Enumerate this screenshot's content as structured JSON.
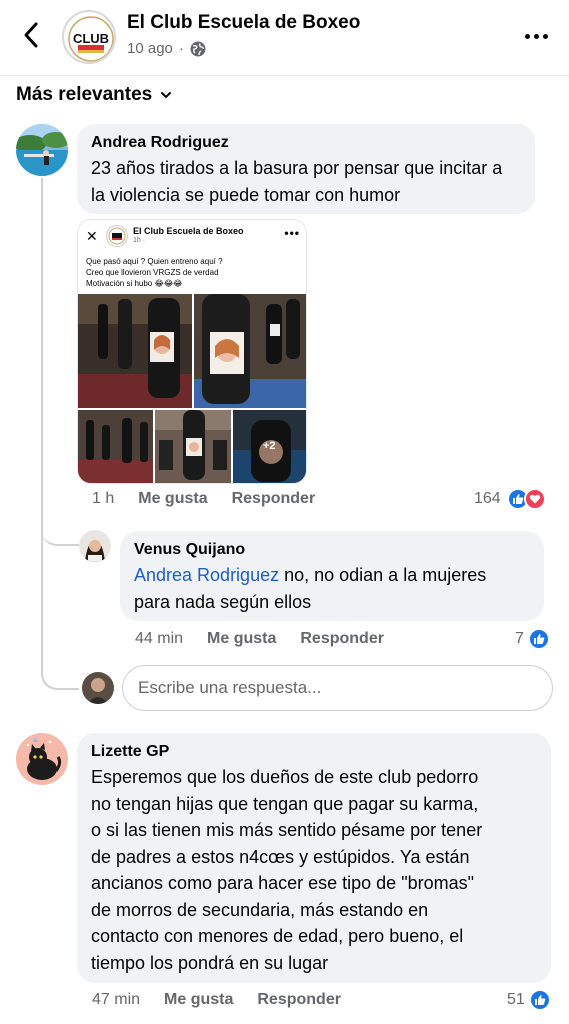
{
  "header": {
    "title": "El Club Escuela de Boxeo",
    "time": "10 ago",
    "dot": "·",
    "logo_text": "CLUB",
    "icons": {
      "back": "chevron-left-icon",
      "privacy": "globe-icon",
      "more": "more-dots-icon"
    }
  },
  "sort": {
    "label": "Más relevantes",
    "icon": "chevron-down-icon"
  },
  "comments": [
    {
      "author": "Andrea Rodriguez",
      "text": "23 años tirados a la basura por pensar que incitar a la violencia se puede tomar con humor",
      "time": "1 h",
      "like_label": "Me gusta",
      "reply_label": "Responder",
      "reaction_count": "164",
      "reactions": [
        "like",
        "love"
      ],
      "attachment": {
        "page_name": "El Club Escuela de Boxeo",
        "time": "1h · ",
        "close": "✕",
        "more": "•••",
        "lines": [
          "Que pasó aquí ? Quien entreno aquí ?",
          "Creo que llovieron VRGZS de verdad",
          "Motivación si hubo 😂😂😂"
        ],
        "more_photos": "+2"
      },
      "replies": [
        {
          "author": "Venus Quijano",
          "mention": "Andrea Rodriguez",
          "text_line1": " no, no odian a la mujeres",
          "text_line2": "para nada según ellos",
          "time": "44 min",
          "like_label": "Me gusta",
          "reply_label": "Responder",
          "reaction_count": "7",
          "reactions": [
            "like"
          ]
        }
      ],
      "reply_input_placeholder": "Escribe una respuesta..."
    },
    {
      "author": "Lizette GP",
      "text_lines": [
        "Esperemos que los dueños de este club pedorro",
        "no tengan hijas que tengan que pagar su karma,",
        "o si las tienen mis más sentido pésame por tener",
        "de padres a estos n4cœs y estúpidos. Ya están",
        "ancianos como para hacer ese tipo de \"bromas\"",
        "de morros de secundaria, más estando en",
        "contacto con menores de edad, pero bueno, el",
        "tiempo los pondrá en su lugar"
      ],
      "time": "47 min",
      "like_label": "Me gusta",
      "reply_label": "Responder",
      "reaction_count": "51",
      "reactions": [
        "like"
      ]
    }
  ],
  "colors": {
    "link": "#1d5fbf",
    "like": "#1b74e4",
    "love": "#f33e58",
    "bubble": "#f0f2f5",
    "muted": "#65676b"
  }
}
